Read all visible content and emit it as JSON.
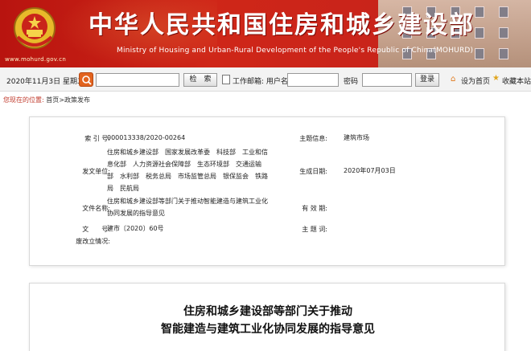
{
  "header": {
    "title": "中华人民共和国住房和城乡建设部",
    "subtitle": "Ministry of Housing and Urban-Rural Development of the People's Republic of China(MOHURD)",
    "url": "www.mohurd.gov.cn",
    "brand_color": "#c9241a"
  },
  "toolbar": {
    "date": "2020年11月3日 星期二",
    "search_button": "检　索",
    "user_label": "工作邮箱: 用户名",
    "password_label": "密码",
    "login_button": "登录",
    "home_link": "设为首页",
    "favorite_link": "收藏本站"
  },
  "breadcrumb": {
    "label": "您现在的位置:",
    "path": "首页>政策发布"
  },
  "info": {
    "index_label": "索 引 号:",
    "index_value": "000013338/2020-00264",
    "topic_label": "主题信息:",
    "topic_value": "建筑市场",
    "issuer_label": "发文单位:",
    "issuer_lines": [
      "住房和城乡建设部　国家发展改革委　科技部　工业和信",
      "息化部　人力资源社会保障部　生态环境部　交通运输",
      "部　水利部　税务总局　市场监管总局　银保监会　铁路",
      "局　民航局"
    ],
    "date_label": "生成日期:",
    "date_value": "2020年07月03日",
    "doc_name_label": "文件名称:",
    "doc_name_lines": [
      "住房和城乡建设部等部门关于推动智能建造与建筑工业化",
      "协同发展的指导意见"
    ],
    "validity_label": "有 效 期:",
    "validity_value": "",
    "doc_no_label": "文　　号:",
    "doc_no_value": "建市〔2020〕60号",
    "keyword_label": "主 题 词:",
    "keyword_value": "",
    "repeal_label": "废改立情况:",
    "repeal_value": ""
  },
  "article": {
    "title_line1": "住房和城乡建设部等部门关于推动",
    "title_line2": "智能建造与建筑工业化协同发展的指导意见"
  }
}
